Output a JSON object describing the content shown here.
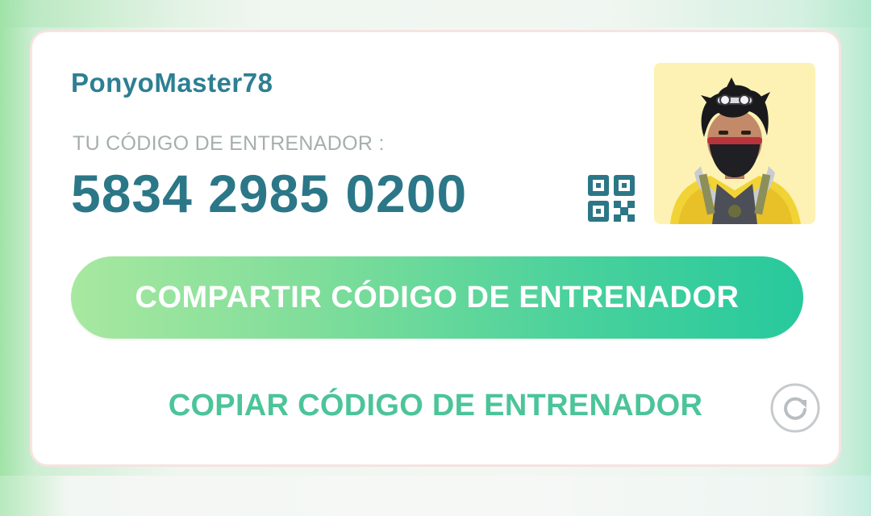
{
  "trainer": {
    "username": "PonyoMaster78",
    "code_label": "TU CÓDIGO DE ENTRENADOR :",
    "code": "5834 2985 0200"
  },
  "actions": {
    "share_label": "COMPARTIR CÓDIGO DE ENTRENADOR",
    "copy_label": "COPIAR CÓDIGO DE ENTRENADOR"
  },
  "icons": {
    "qr": "qr-code-icon",
    "refresh": "refresh-icon",
    "avatar": "trainer-avatar"
  },
  "colors": {
    "username": "#2d7f92",
    "code": "#2b7788",
    "label": "#a6aeae",
    "share_gradient_start": "#a8e8a0",
    "share_gradient_end": "#27c99d",
    "copy_text": "#4cc49a",
    "avatar_bg": "#fdf2b3",
    "card_border": "#f6e3e0"
  }
}
